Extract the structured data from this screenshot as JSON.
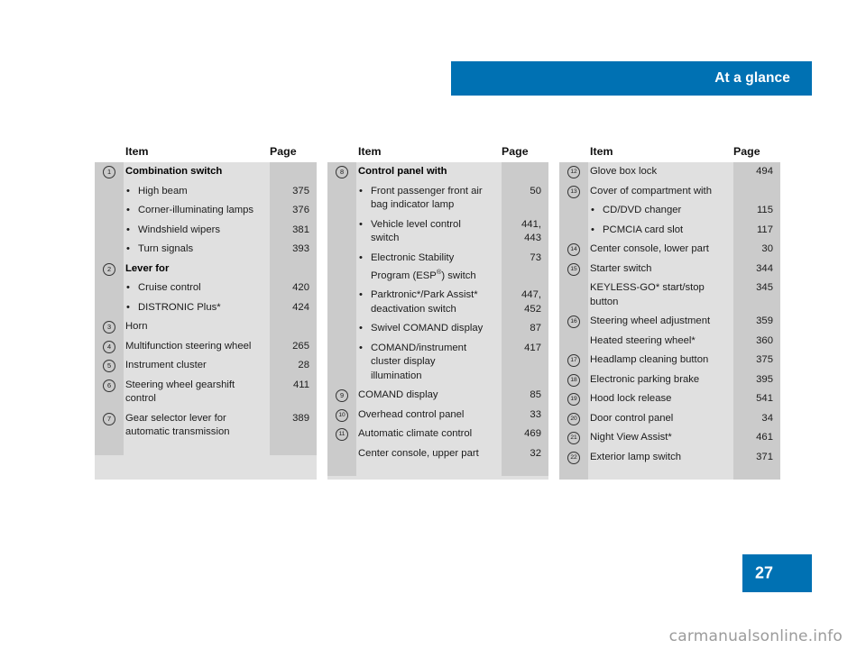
{
  "header": {
    "title": "At a glance",
    "band_color": "#0071b3"
  },
  "page_footer": {
    "page_number": "27",
    "box_color": "#0071b3"
  },
  "watermark": {
    "text": "carmanualsonline.info"
  },
  "columns": [
    {
      "id": "column-1",
      "head": {
        "item": "Item",
        "page": "Page"
      },
      "rows": [
        {
          "num": "1",
          "label": "Combination switch",
          "page": "",
          "bold": true,
          "bullet": false
        },
        {
          "num": "",
          "label": "High beam",
          "page": "375",
          "bold": false,
          "bullet": true
        },
        {
          "num": "",
          "label": "Corner-illuminating lamps",
          "page": "376",
          "bold": false,
          "bullet": true
        },
        {
          "num": "",
          "label": "Windshield wipers",
          "page": "381",
          "bold": false,
          "bullet": true
        },
        {
          "num": "",
          "label": "Turn signals",
          "page": "393",
          "bold": false,
          "bullet": true
        },
        {
          "num": "2",
          "label": "Lever for",
          "page": "",
          "bold": true,
          "bullet": false
        },
        {
          "num": "",
          "label": "Cruise control",
          "page": "420",
          "bold": false,
          "bullet": true
        },
        {
          "num": "",
          "label": "DISTRONIC Plus*",
          "page": "424",
          "bold": false,
          "bullet": true
        },
        {
          "num": "3",
          "label": "Horn",
          "page": "",
          "bold": false,
          "bullet": false
        },
        {
          "num": "4",
          "label": "Multifunction steering wheel",
          "page": "265",
          "bold": false,
          "bullet": false
        },
        {
          "num": "5",
          "label": "Instrument cluster",
          "page": "28",
          "bold": false,
          "bullet": false
        },
        {
          "num": "6",
          "label": "Steering wheel gearshift control",
          "page": "411",
          "bold": false,
          "bullet": false
        },
        {
          "num": "7",
          "label": "Gear selector lever for automatic transmission",
          "page": "389",
          "bold": false,
          "bullet": false
        }
      ]
    },
    {
      "id": "column-2",
      "head": {
        "item": "Item",
        "page": "Page"
      },
      "rows": [
        {
          "num": "8",
          "label": "Control panel with",
          "page": "",
          "bold": true,
          "bullet": false
        },
        {
          "num": "",
          "label": "Front passenger front air bag indicator lamp",
          "page": "50",
          "bold": false,
          "bullet": true
        },
        {
          "num": "",
          "label": "Vehicle level control switch",
          "page": "441,\n443",
          "bold": false,
          "bullet": true
        },
        {
          "num": "",
          "label": "Electronic Stability Program (ESP®) switch",
          "page": "73",
          "bold": false,
          "bullet": true,
          "esp": true
        },
        {
          "num": "",
          "label": "Parktronic*/Park Assist* deactivation switch",
          "page": "447,\n452",
          "bold": false,
          "bullet": true
        },
        {
          "num": "",
          "label": "Swivel COMAND display",
          "page": "87",
          "bold": false,
          "bullet": true
        },
        {
          "num": "",
          "label": "COMAND/instrument cluster display illumination",
          "page": "417",
          "bold": false,
          "bullet": true
        },
        {
          "num": "9",
          "label": "COMAND display",
          "page": "85",
          "bold": false,
          "bullet": false
        },
        {
          "num": "10",
          "label": "Overhead control panel",
          "page": "33",
          "bold": false,
          "bullet": false
        },
        {
          "num": "11",
          "label": "Automatic climate control",
          "page": "469",
          "bold": false,
          "bullet": false
        },
        {
          "num": "",
          "label": "Center console, upper part",
          "page": "32",
          "bold": false,
          "bullet": false
        }
      ]
    },
    {
      "id": "column-3",
      "head": {
        "item": "Item",
        "page": "Page"
      },
      "rows": [
        {
          "num": "12",
          "label": "Glove box lock",
          "page": "494",
          "bold": false,
          "bullet": false
        },
        {
          "num": "13",
          "label": "Cover of compartment with",
          "page": "",
          "bold": false,
          "bullet": false
        },
        {
          "num": "",
          "label": "CD/DVD changer",
          "page": "115",
          "bold": false,
          "bullet": true
        },
        {
          "num": "",
          "label": "PCMCIA card slot",
          "page": "117",
          "bold": false,
          "bullet": true
        },
        {
          "num": "14",
          "label": "Center console, lower part",
          "page": "30",
          "bold": false,
          "bullet": false
        },
        {
          "num": "15",
          "label": "Starter switch",
          "page": "344",
          "bold": false,
          "bullet": false
        },
        {
          "num": "",
          "label": "KEYLESS-GO* start/stop button",
          "page": "345",
          "bold": false,
          "bullet": false
        },
        {
          "num": "16",
          "label": "Steering wheel adjustment",
          "page": "359",
          "bold": false,
          "bullet": false
        },
        {
          "num": "",
          "label": "Heated steering wheel*",
          "page": "360",
          "bold": false,
          "bullet": false
        },
        {
          "num": "17",
          "label": "Headlamp cleaning button",
          "page": "375",
          "bold": false,
          "bullet": false
        },
        {
          "num": "18",
          "label": "Electronic parking brake",
          "page": "395",
          "bold": false,
          "bullet": false
        },
        {
          "num": "19",
          "label": "Hood lock release",
          "page": "541",
          "bold": false,
          "bullet": false
        },
        {
          "num": "20",
          "label": "Door control panel",
          "page": "34",
          "bold": false,
          "bullet": false
        },
        {
          "num": "21",
          "label": "Night View Assist*",
          "page": "461",
          "bold": false,
          "bullet": false
        },
        {
          "num": "22",
          "label": "Exterior lamp switch",
          "page": "371",
          "bold": false,
          "bullet": false
        }
      ]
    }
  ]
}
